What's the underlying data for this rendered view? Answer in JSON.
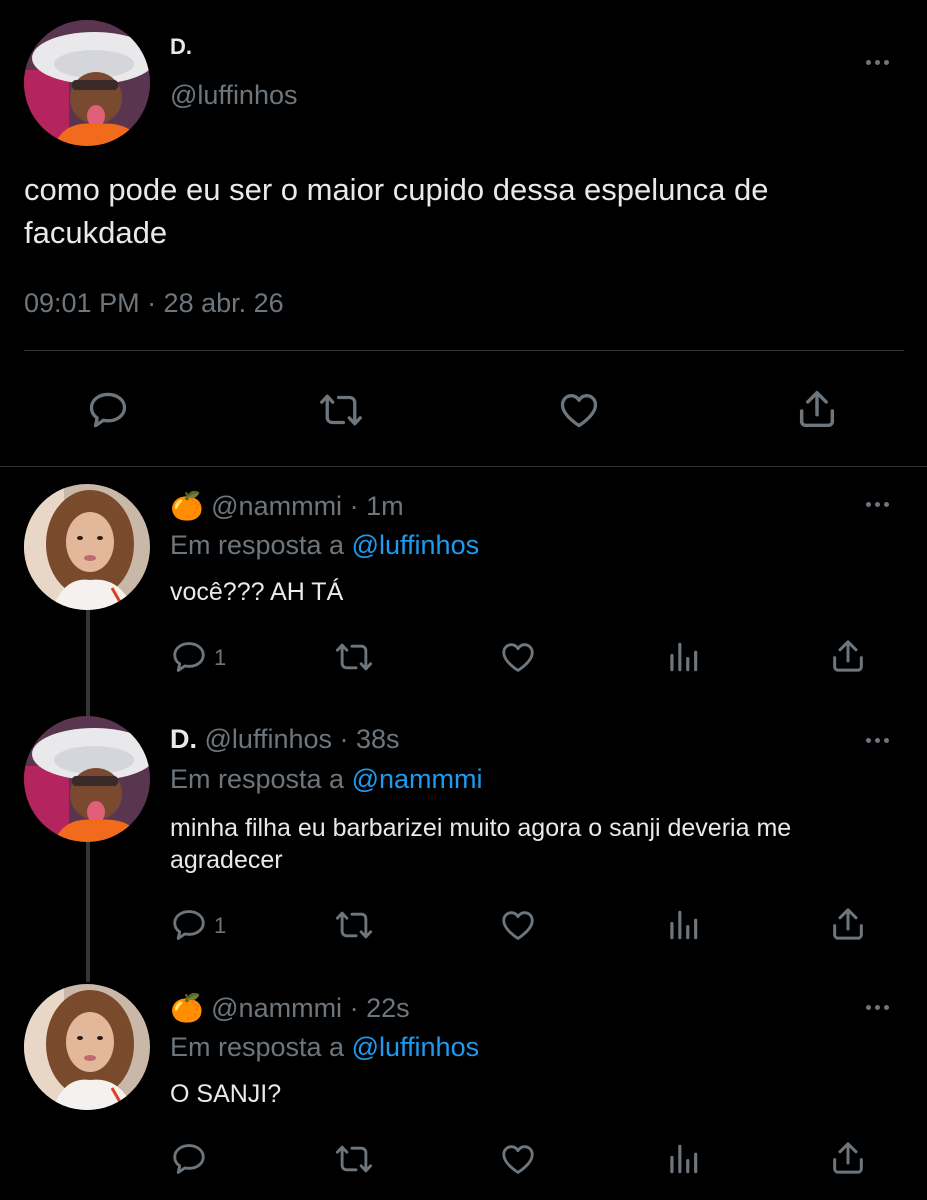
{
  "main_tweet": {
    "display_name": "D.",
    "handle": "@luffinhos",
    "text": "como pode eu ser o maior cupido dessa espelunca de facukdade",
    "timestamp": "09:01 PM · 28 abr. 26"
  },
  "replies": [
    {
      "emoji": "🍊",
      "handle": "@nammmi",
      "time": "· 1m",
      "reply_prefix": "Em resposta a",
      "reply_to": "@luffinhos",
      "text": "você??? AH TÁ",
      "reply_count": "1"
    },
    {
      "display_name": "D.",
      "handle": "@luffinhos",
      "time": "· 38s",
      "reply_prefix": "Em resposta a",
      "reply_to": "@nammmi",
      "text": "minha filha eu barbarizei muito agora o sanji deveria me agradecer",
      "reply_count": "1"
    },
    {
      "emoji": "🍊",
      "handle": "@nammmi",
      "time": "· 22s",
      "reply_prefix": "Em resposta a",
      "reply_to": "@luffinhos",
      "text": "O SANJI?",
      "reply_count": ""
    }
  ],
  "colors": {
    "background": "#000000",
    "text": "#e7e9ea",
    "muted": "#6e767d",
    "link": "#1d9bf0"
  },
  "icons": [
    "reply-icon",
    "retweet-icon",
    "like-icon",
    "share-icon",
    "analytics-icon",
    "more-icon"
  ]
}
